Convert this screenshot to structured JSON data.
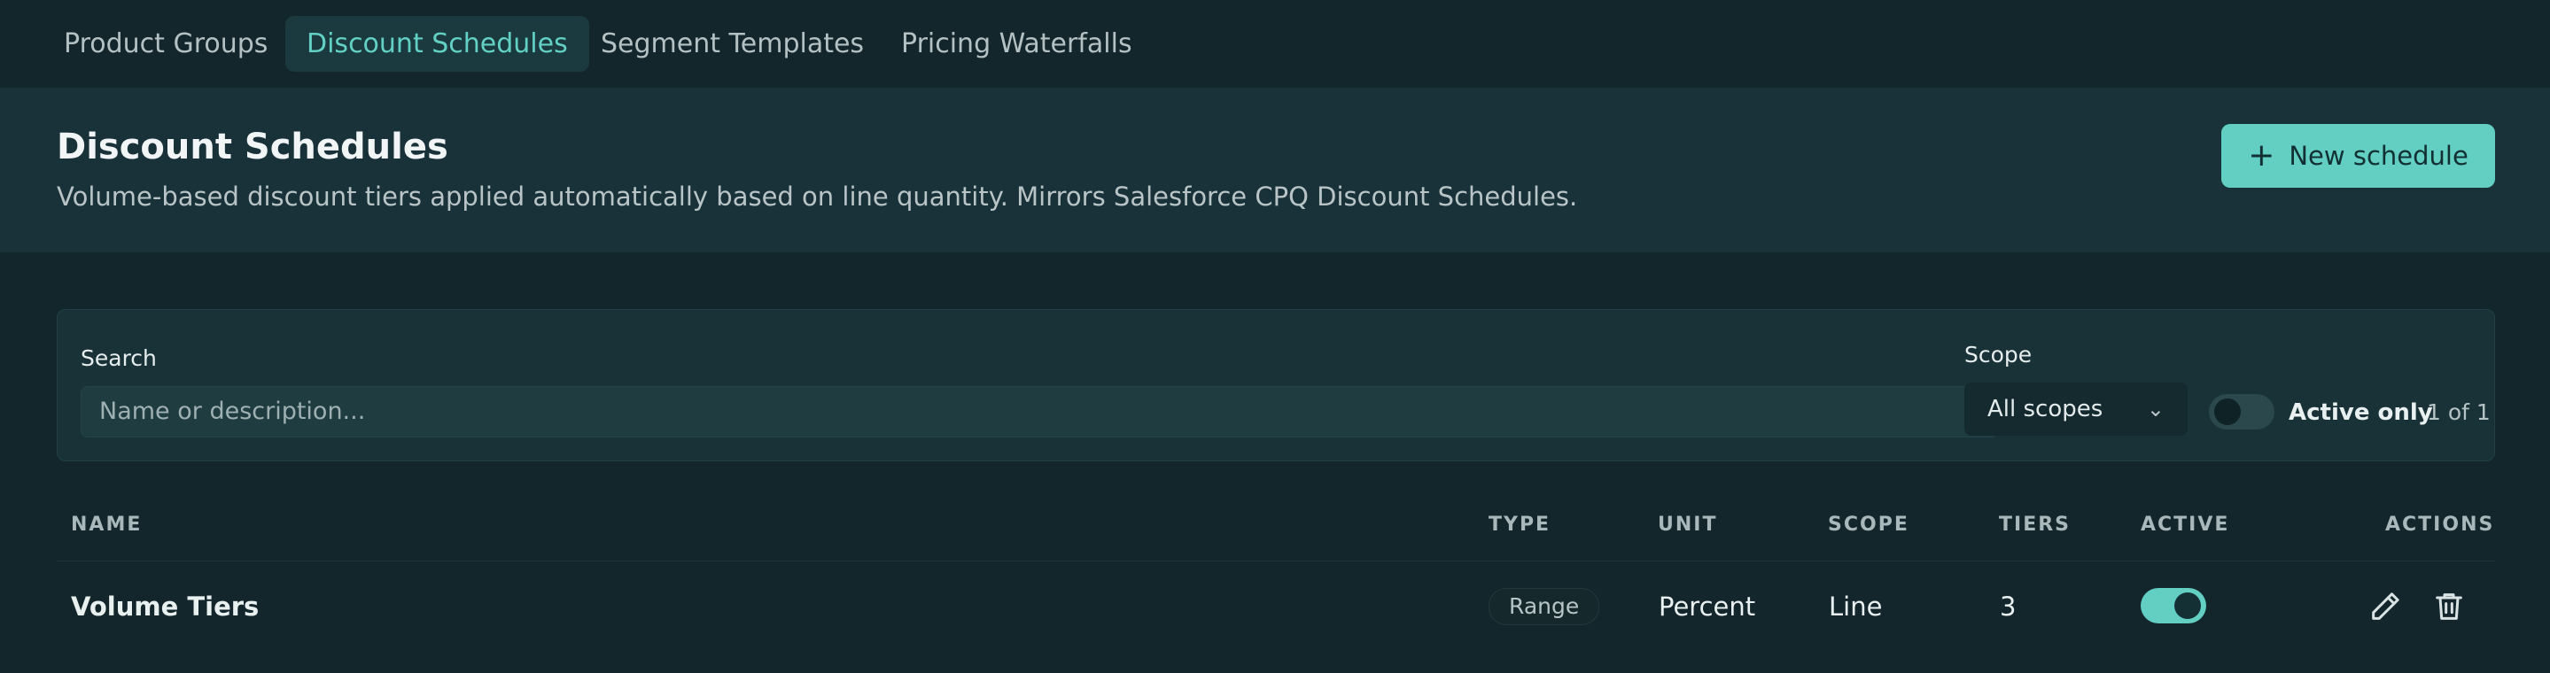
{
  "tabs": [
    {
      "label": "Product Groups"
    },
    {
      "label": "Discount Schedules",
      "active": true
    },
    {
      "label": "Segment Templates"
    },
    {
      "label": "Pricing Waterfalls"
    }
  ],
  "header": {
    "title": "Discount Schedules",
    "subtitle": "Volume-based discount tiers applied automatically based on line quantity. Mirrors Salesforce CPQ Discount Schedules.",
    "new_button_label": "New schedule",
    "new_button_icon": "plus-icon"
  },
  "filters": {
    "search_label": "Search",
    "search_placeholder": "Name or description...",
    "search_value": "",
    "scope_label": "Scope",
    "scope_selected": "All scopes",
    "active_only_label": "Active only",
    "active_only_enabled": false,
    "count_label": "1 of 1"
  },
  "table": {
    "columns": [
      "NAME",
      "TYPE",
      "UNIT",
      "SCOPE",
      "TIERS",
      "ACTIVE",
      "ACTIONS"
    ],
    "rows": [
      {
        "name": "Volume Tiers",
        "type": "Range",
        "unit": "Percent",
        "scope": "Line",
        "tiers": "3",
        "active": true,
        "actions": [
          "edit-icon",
          "trash-icon"
        ]
      }
    ]
  },
  "colors": {
    "background": "#13262b",
    "header_band": "#193239",
    "accent": "#62cfc2",
    "active_tab_text": "#62d0c4"
  }
}
